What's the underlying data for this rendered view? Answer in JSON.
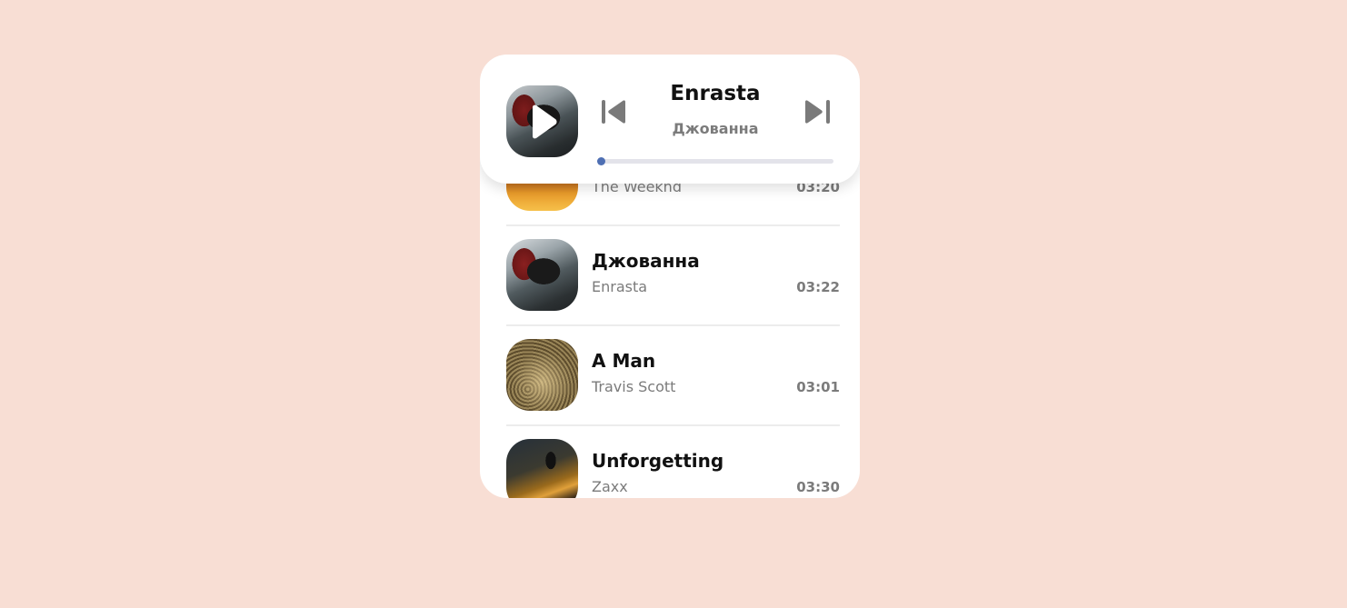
{
  "player": {
    "title": "Enrasta",
    "artist": "Джованна",
    "progress": 0.0,
    "accent_color": "#5a79b9",
    "icons": {
      "play": "play-icon",
      "previous": "skip-previous-icon",
      "next": "skip-next-icon"
    }
  },
  "tracks": [
    {
      "title": "",
      "artist": "The Weeknd",
      "duration": "03:20"
    },
    {
      "title": "Джованна",
      "artist": "Enrasta",
      "duration": "03:22"
    },
    {
      "title": "A Man",
      "artist": "Travis Scott",
      "duration": "03:01"
    },
    {
      "title": "Unforgetting",
      "artist": "Zaxx",
      "duration": "03:30"
    }
  ],
  "colors": {
    "background": "#f8ded4",
    "card": "#ffffff",
    "text_primary": "#111111",
    "text_secondary": "#7b7b7b"
  }
}
